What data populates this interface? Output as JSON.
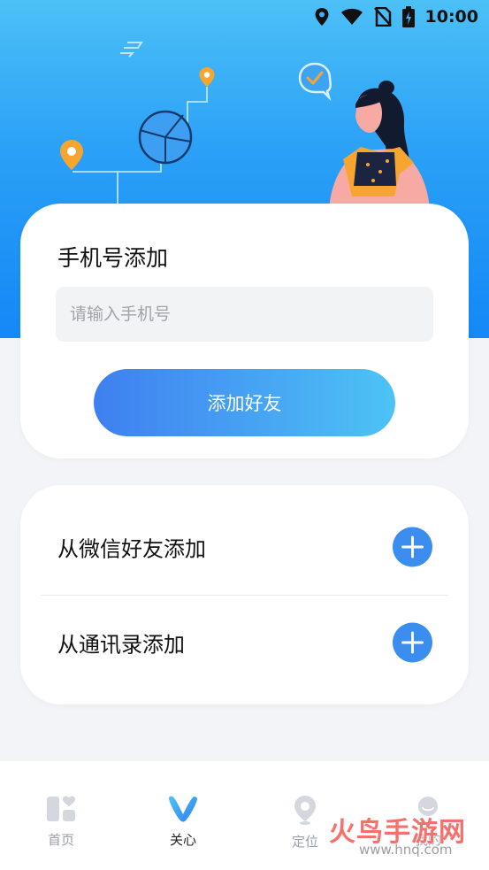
{
  "status_bar": {
    "time": "10:00",
    "icons": [
      "location-icon",
      "wifi-icon",
      "no-sim-icon",
      "battery-icon"
    ]
  },
  "phone_add": {
    "title": "手机号添加",
    "input_placeholder": "请输入手机号",
    "input_value": "",
    "button_label": "添加好友"
  },
  "sources": {
    "items": [
      {
        "label": "从微信好友添加",
        "icon": "plus-icon"
      },
      {
        "label": "从通讯录添加",
        "icon": "plus-icon"
      }
    ]
  },
  "tabbar": {
    "items": [
      {
        "label": "首页",
        "icon": "home-icon",
        "active": false
      },
      {
        "label": "关心",
        "icon": "care-icon",
        "active": true
      },
      {
        "label": "定位",
        "icon": "location-pin-icon",
        "active": false
      },
      {
        "label": "我的",
        "icon": "profile-icon",
        "active": false
      }
    ]
  },
  "watermark": {
    "brand": "火鸟手游网",
    "url": "www.hnq.com"
  },
  "colors": {
    "hero_top": "#4cc0f6",
    "hero_bottom": "#1488f6",
    "button_start": "#3f7ff0",
    "button_end": "#4dc3f5",
    "plus_button": "#3b8df0",
    "page_background": "#f3f4f7"
  }
}
